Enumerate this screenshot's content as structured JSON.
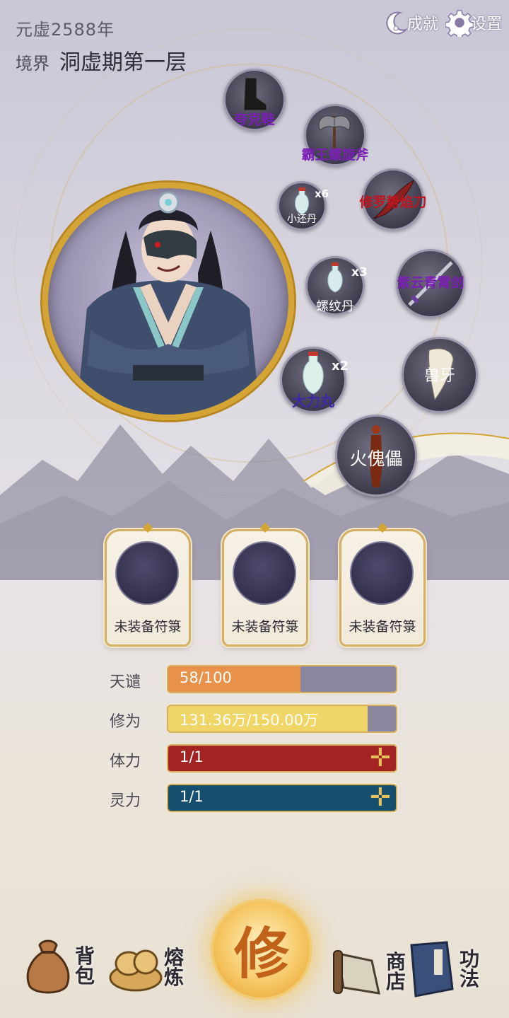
{
  "header": {
    "year": "元虚2588年",
    "realm_label": "境界",
    "realm_value": "洞虚期第一层",
    "achievements_label": "成就",
    "settings_label": "设置"
  },
  "equipment": [
    {
      "name": "夸克鞋",
      "color": "#7a1fb3",
      "icon": "boots-icon"
    },
    {
      "name": "霸王螺旋斧",
      "color": "#7a1fb3",
      "icon": "axe-icon"
    },
    {
      "name": "修罗势焰刀",
      "color": "#c0151d",
      "icon": "blade-icon"
    },
    {
      "name": "紫云青霄剑",
      "color": "#7a1fb3",
      "icon": "sword-icon"
    },
    {
      "name": "兽牙",
      "color": "#ffffff",
      "icon": "fang-icon"
    },
    {
      "name": "火傀儡",
      "color": "#ffffff",
      "icon": "puppet-icon"
    }
  ],
  "consumables": [
    {
      "name": "小还丹",
      "qty": "x6",
      "color": "#ffffff"
    },
    {
      "name": "螺纹丹",
      "qty": "x3",
      "color": "#ffffff"
    },
    {
      "name": "大力丸",
      "qty": "x2",
      "color": "#3b2aa8"
    }
  ],
  "talisman_slots": [
    "未装备符箓",
    "未装备符箓",
    "未装备符箓"
  ],
  "stats": [
    {
      "label": "天谴",
      "text": "58/100",
      "progress": 0.58,
      "color": "#e8914a",
      "plus": false
    },
    {
      "label": "修为",
      "text": "131.36万/150.00万",
      "progress": 0.876,
      "color": "#efd667",
      "plus": false
    },
    {
      "label": "体力",
      "text": "1/1",
      "progress": 1.0,
      "color": "#a32323",
      "plus": true
    },
    {
      "label": "灵力",
      "text": "1/1",
      "progress": 1.0,
      "color": "#164f6e",
      "plus": true
    }
  ],
  "nav": {
    "bag_label": "背包",
    "smelt_label": "熔炼",
    "cultivate_label": "修",
    "shop_label": "商店",
    "skills_label": "功法"
  }
}
